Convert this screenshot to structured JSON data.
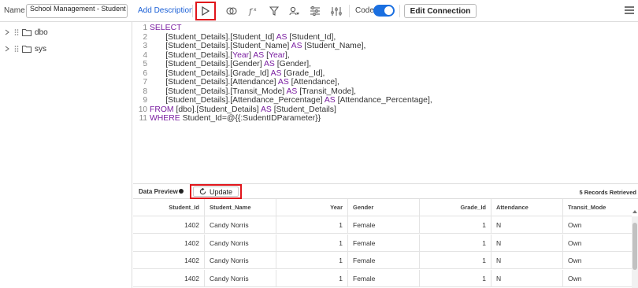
{
  "toolbar": {
    "name_label": "Name",
    "name_value": "School Management - Student dataso",
    "add_description": "Add Description",
    "code_label": "Code",
    "edit_connection": "Edit Connection"
  },
  "tree": {
    "items": [
      {
        "label": "dbo"
      },
      {
        "label": "sys"
      }
    ]
  },
  "editor": {
    "line_numbers": [
      "1",
      "2",
      "3",
      "4",
      "5",
      "6",
      "7",
      "8",
      "9",
      "10",
      "11"
    ]
  },
  "preview": {
    "label": "Data Preview",
    "update_button": "Update",
    "records": "5 Records Retrieved"
  },
  "table": {
    "columns": [
      "Student_Id",
      "Student_Name",
      "Year",
      "Gender",
      "Grade_Id",
      "Attendance",
      "Transit_Mode"
    ],
    "rows": [
      [
        "1402",
        "Candy Norris",
        "1",
        "Female",
        "1",
        "N",
        "Own"
      ],
      [
        "1402",
        "Candy Norris",
        "1",
        "Female",
        "1",
        "N",
        "Own"
      ],
      [
        "1402",
        "Candy Norris",
        "1",
        "Female",
        "1",
        "N",
        "Own"
      ],
      [
        "1402",
        "Candy Norris",
        "1",
        "Female",
        "1",
        "N",
        "Own"
      ]
    ]
  },
  "colors": {
    "accent": "#1a6fe0",
    "highlight": "#e0151b",
    "keyword": "#7a1ea1"
  }
}
